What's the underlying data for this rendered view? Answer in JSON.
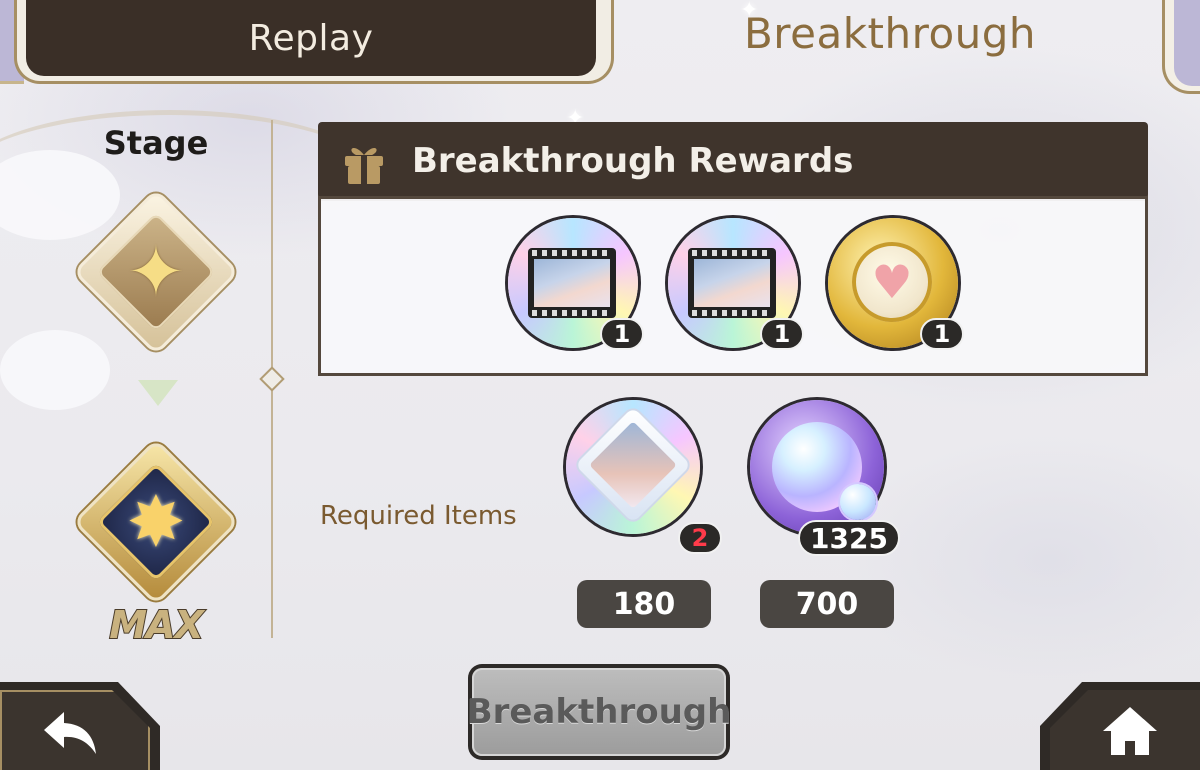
{
  "tabs": {
    "replay_label": "Replay",
    "breakthrough_label": "Breakthrough"
  },
  "stage": {
    "title": "Stage",
    "current_icon": "sparkle-star-icon",
    "next_icon": "burst-star-icon",
    "max_label": "MAX"
  },
  "rewards": {
    "title": "Breakthrough Rewards",
    "header_icon": "gift-icon",
    "items": [
      {
        "name": "memory-film-icon",
        "count": "1"
      },
      {
        "name": "memory-film-icon",
        "count": "1"
      },
      {
        "name": "heart-coin-icon",
        "count": "1"
      }
    ]
  },
  "required": {
    "label": "Required Items",
    "items": [
      {
        "name": "character-shard-icon",
        "count": "2",
        "cost": "180",
        "count_color": "#ff3b4a"
      },
      {
        "name": "bubble-orb-icon",
        "count": "1325",
        "cost": "700"
      }
    ]
  },
  "actions": {
    "breakthrough_button": "Breakthrough",
    "back_icon": "back-arrow-icon",
    "home_icon": "home-icon"
  }
}
